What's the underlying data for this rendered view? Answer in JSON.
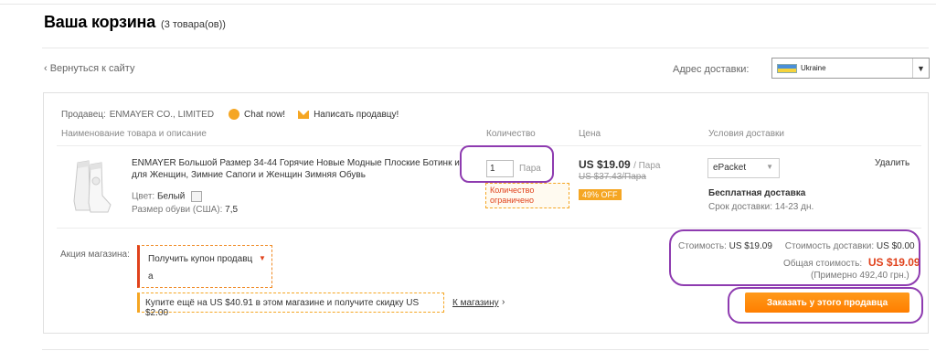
{
  "header": {
    "title": "Ваша корзина",
    "item_count": "(3 товара(ов))"
  },
  "nav": {
    "back_link": "‹ Вернуться к сайту"
  },
  "shipping_address": {
    "label": "Адрес доставки:",
    "country": "Ukraine"
  },
  "seller": {
    "label": "Продавец:",
    "name": "ENMAYER CO., LIMITED",
    "chat_label": "Chat now!",
    "message_label": "Написать продавцу!"
  },
  "columns": {
    "name": "Наименование товара и описание",
    "quantity": "Количество",
    "price": "Цена",
    "shipping": "Условия доставки"
  },
  "product": {
    "title": "ENMAYER Большой Размер 34-44 Горячие Новые Модные Плоские Ботинк и для Женщин, Зимние Сапоги и Женщин Зимняя Обувь",
    "color_label": "Цвет:",
    "color_value": "Белый",
    "size_label": "Размер обуви (США):",
    "size_value": "7,5",
    "quantity": "1",
    "quantity_unit": "Пара",
    "quantity_limit": "Количество ограничено",
    "price": "US $19.09",
    "price_unit": "/ Пара",
    "old_price": "US $37.43/Пара",
    "discount": "49% OFF",
    "shipping_method": "ePacket",
    "free_shipping": "Бесплатная доставка",
    "delivery_time": "Срок доставки: 14-23 дн.",
    "remove_label": "Удалить"
  },
  "promo": {
    "label": "Акция магазина:",
    "coupon_select": "Получить купон продавц",
    "coupon_select_cont": "а",
    "upsell": "Купите ещё на US $40.91 в этом магазине и получите скидку US $2.00",
    "store_link": "К магазину",
    "store_arrow": "›"
  },
  "summary": {
    "cost_label": "Стоимость:",
    "cost_value": "US $19.09",
    "shipping_label": "Стоимость доставки:",
    "shipping_value": "US $0.00",
    "total_label": "Общая стоимость:",
    "total_value": "US $19.09",
    "approx": "(Примерно 492,40 грн.)",
    "order_button": "Заказать у этого продавца"
  },
  "colors": {
    "accent_orange": "#ff7e00",
    "price_red": "#e0421c",
    "highlight_purple": "#8e3bb0"
  }
}
